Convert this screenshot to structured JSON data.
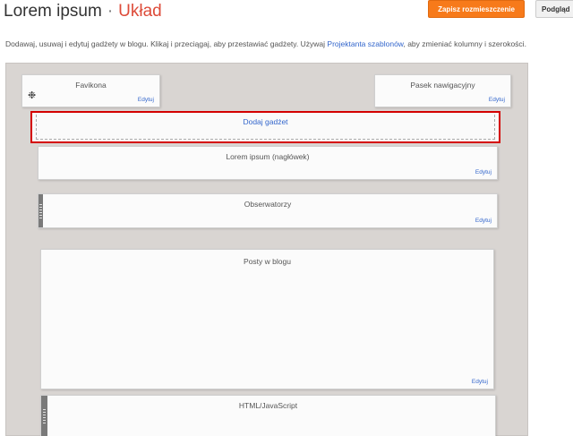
{
  "header": {
    "blog_title": "Lorem ipsum",
    "separator": "·",
    "page_title": "Układ",
    "save_button": "Zapisz rozmieszczenie",
    "preview_button": "Podgląd"
  },
  "description": {
    "text_before": "Dodawaj, usuwaj i edytuj gadżety w blogu. Klikaj i przeciągaj, aby przestawiać gadżety. Używaj",
    "link": "Projektanta szablonów",
    "text_after": ", aby zmieniać kolumny i szerokości."
  },
  "gadgets": {
    "favicon": {
      "name": "Favikona",
      "edit": "Edytuj"
    },
    "navbar": {
      "name": "Pasek nawigacyjny",
      "edit": "Edytuj"
    },
    "add_gadget": {
      "label": "Dodaj gadżet"
    },
    "header": {
      "name": "Lorem ipsum (nagłówek)",
      "edit": "Edytuj"
    },
    "followers": {
      "name": "Obserwatorzy",
      "edit": "Edytuj"
    },
    "posts": {
      "name": "Posty w blogu",
      "edit": "Edytuj"
    },
    "html": {
      "name": "HTML/JavaScript"
    }
  },
  "colors": {
    "accent": "#dd4b39",
    "save_button": "#f77a1a",
    "link": "#3366cc",
    "highlight_border": "#d40000",
    "canvas": "#d9d5d2"
  },
  "icons": {
    "favicon": "gear-icon"
  }
}
